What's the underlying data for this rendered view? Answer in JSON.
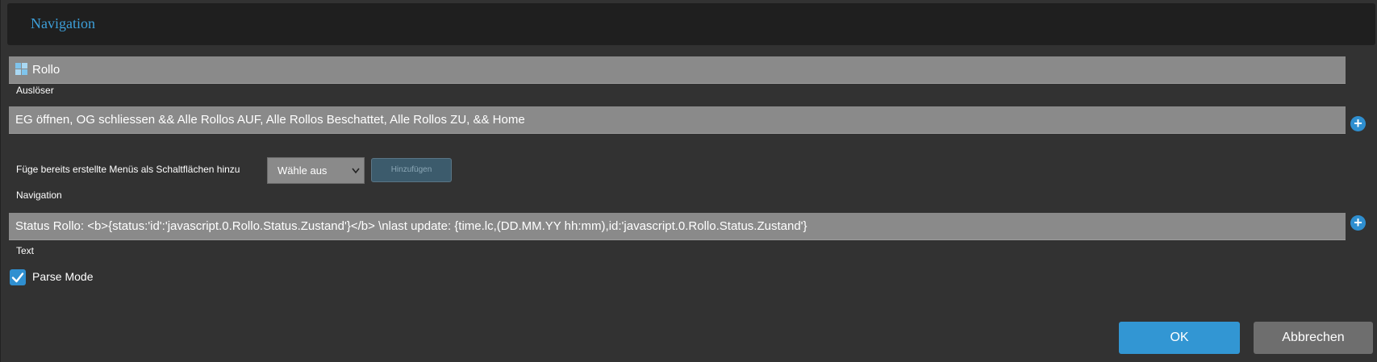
{
  "dialog": {
    "title": "Navigation"
  },
  "menu_field": {
    "icon": "window-icon",
    "value": "Rollo"
  },
  "trigger": {
    "label": "Auslöser"
  },
  "navigation_field": {
    "value": "EG öffnen, OG schliessen && Alle Rollos AUF, Alle Rollos Beschattet, Alle Rollos ZU,  && Home",
    "add_icon": "plus-circle-icon"
  },
  "add_menus": {
    "label": "Füge bereits erstellte Menüs als Schaltflächen hinzu",
    "select_value": "Wähle aus",
    "button_label": "Hinzufügen"
  },
  "navigation": {
    "label": "Navigation"
  },
  "text_field": {
    "value": "Status Rollo: <b>{status:'id':'javascript.0.Rollo.Status.Zustand'}</b>  \\nlast update:  {time.lc,(DD.MM.YY hh:mm),id:'javascript.0.Rollo.Status.Zustand'}",
    "add_icon": "plus-circle-icon"
  },
  "text": {
    "label": "Text"
  },
  "parse_mode": {
    "label": "Parse Mode",
    "checked": true
  },
  "footer": {
    "ok_label": "OK",
    "cancel_label": "Abbrechen"
  },
  "colors": {
    "accent": "#3296d3",
    "title": "#3d9fd9",
    "field_bg": "#8a8a8a",
    "dialog_bg": "#323232",
    "titlebar_bg": "#1f1f1f"
  }
}
